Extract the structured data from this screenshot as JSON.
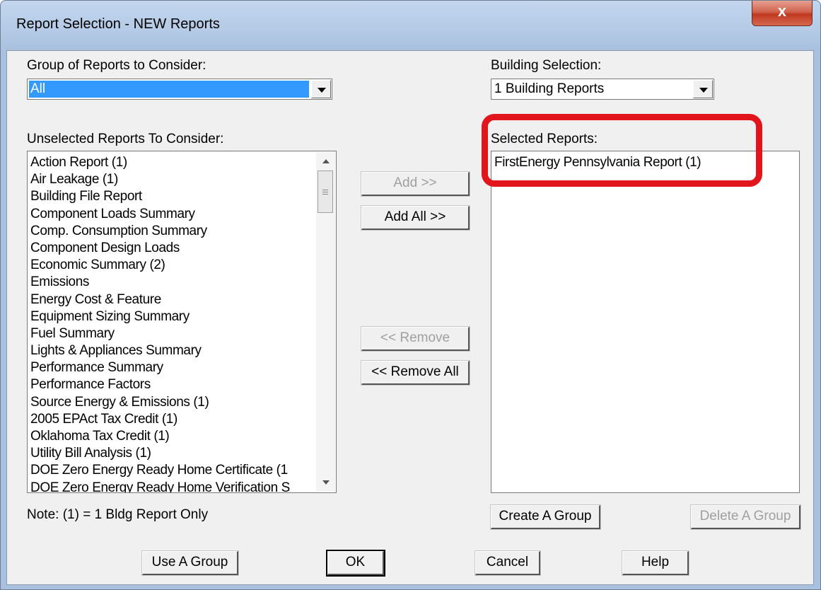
{
  "window": {
    "title": "Report Selection - NEW Reports",
    "close_label": "x"
  },
  "group_of_reports": {
    "label": "Group of Reports to Consider:",
    "value": "All"
  },
  "building_selection": {
    "label": "Building Selection:",
    "value": "1 Building Reports"
  },
  "unselected": {
    "label": "Unselected Reports To Consider:",
    "items": [
      "Action Report (1)",
      "Air Leakage (1)",
      "Building File Report",
      "Component Loads Summary",
      "Comp. Consumption Summary",
      "Component Design Loads",
      "Economic Summary (2)",
      "Emissions",
      "Energy Cost & Feature",
      "Equipment Sizing Summary",
      "Fuel Summary",
      "Lights & Appliances Summary",
      "Performance Summary",
      "Performance Factors",
      "Source Energy & Emissions (1)",
      "2005 EPAct Tax Credit (1)",
      "Oklahoma Tax Credit (1)",
      "Utility Bill Analysis (1)",
      "DOE Zero Energy Ready Home Certificate (1",
      "DOE Zero Energy Ready Home Verification S"
    ]
  },
  "selected": {
    "label": "Selected Reports:",
    "items": [
      "FirstEnergy Pennsylvania Report (1)"
    ]
  },
  "buttons": {
    "add": "Add >>",
    "add_all": "Add All >>",
    "remove": "<< Remove",
    "remove_all": "<< Remove All",
    "create_group": "Create A Group",
    "delete_group": "Delete A Group",
    "use_group": "Use A Group",
    "ok": "OK",
    "cancel": "Cancel",
    "help": "Help"
  },
  "note": "Note: (1) = 1 Bldg Report Only",
  "colors": {
    "highlight": "#e2141c",
    "selection": "#3399ff"
  }
}
